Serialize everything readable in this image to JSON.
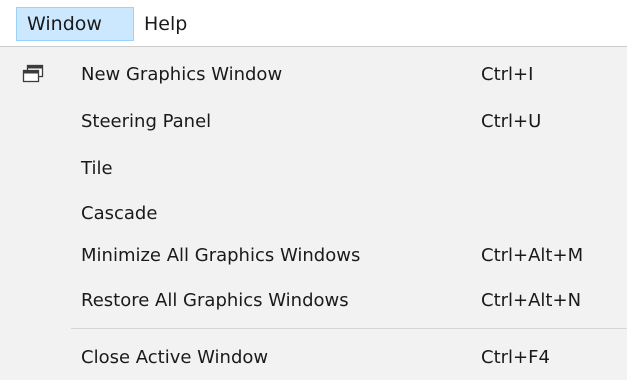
{
  "menubar": {
    "items": [
      {
        "label": "Window",
        "active": true
      },
      {
        "label": "Help",
        "active": false
      }
    ]
  },
  "dropdown": {
    "items": [
      {
        "label": "New Graphics Window",
        "shortcut": "Ctrl+I",
        "icon": "new-window-icon"
      },
      {
        "label": "Steering Panel",
        "shortcut": "Ctrl+U"
      },
      {
        "label": "Tile",
        "shortcut": ""
      },
      {
        "label": "Cascade",
        "shortcut": ""
      },
      {
        "label": "Minimize All Graphics Windows",
        "shortcut": "Ctrl+Alt+M"
      },
      {
        "label": "Restore All Graphics Windows",
        "shortcut": "Ctrl+Alt+N"
      },
      {
        "label": "Close Active Window",
        "shortcut": "Ctrl+F4"
      }
    ]
  },
  "colors": {
    "menubar_active_bg": "#cce8ff",
    "menubar_active_border": "#99d1ff",
    "dropdown_bg": "#f2f2f2",
    "separator": "#d5d5d5"
  }
}
